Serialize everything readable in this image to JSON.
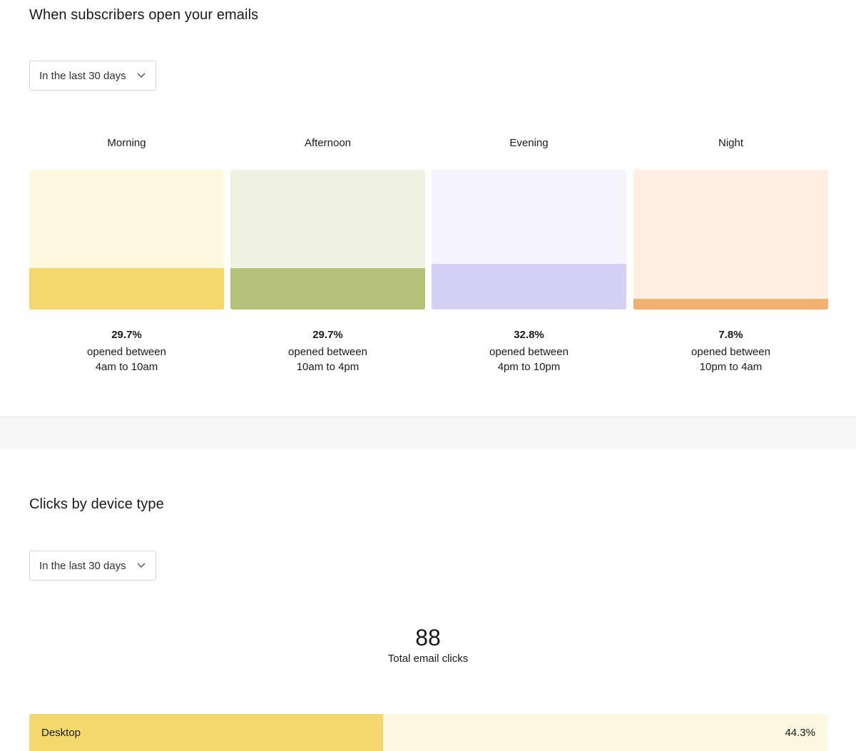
{
  "opens_section": {
    "title": "When subscribers open your emails",
    "range_select": "In the last 30 days",
    "periods": [
      {
        "label": "Morning",
        "percent": "29.7%",
        "fraction": 0.297,
        "desc_line1": "opened between",
        "desc_line2": "4am to 10am",
        "bg_color": "#fdf7e0",
        "fill_color": "#f4d86e"
      },
      {
        "label": "Afternoon",
        "percent": "29.7%",
        "fraction": 0.297,
        "desc_line1": "opened between",
        "desc_line2": "10am to 4pm",
        "bg_color": "#f0f2e3",
        "fill_color": "#b5c078"
      },
      {
        "label": "Evening",
        "percent": "32.8%",
        "fraction": 0.328,
        "desc_line1": "opened between",
        "desc_line2": "4pm to 10pm",
        "bg_color": "#f5f4fd",
        "fill_color": "#d4d0f6"
      },
      {
        "label": "Night",
        "percent": "7.8%",
        "fraction": 0.078,
        "desc_line1": "opened between",
        "desc_line2": "10pm to 4am",
        "bg_color": "#feefe2",
        "fill_color": "#f4b06e"
      }
    ]
  },
  "clicks_section": {
    "title": "Clicks by device type",
    "range_select": "In the last 30 days",
    "total_clicks": "88",
    "total_label": "Total email clicks",
    "devices": [
      {
        "name": "Desktop",
        "percent": "44.3%",
        "fraction": 0.443,
        "bg_color": "#fdf8e1",
        "fill_color": "#f3d86e"
      }
    ]
  }
}
